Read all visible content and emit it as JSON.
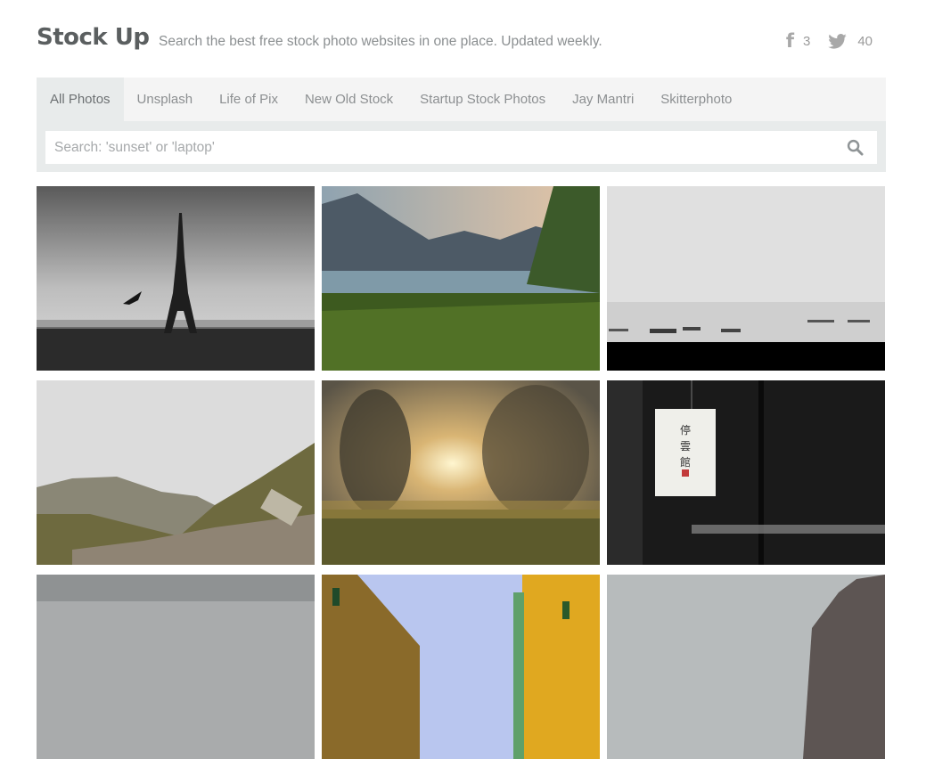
{
  "header": {
    "logo": "Stock Up",
    "tagline": "Search the best free stock photo websites in one place. Updated weekly.",
    "social": {
      "facebook": {
        "icon": "facebook-icon",
        "count": "3"
      },
      "twitter": {
        "icon": "twitter-icon",
        "count": "40"
      }
    }
  },
  "nav": {
    "tabs": [
      {
        "label": "All Photos",
        "active": true
      },
      {
        "label": "Unsplash",
        "active": false
      },
      {
        "label": "Life of Pix",
        "active": false
      },
      {
        "label": "New Old Stock",
        "active": false
      },
      {
        "label": "Startup Stock Photos",
        "active": false
      },
      {
        "label": "Jay Mantri",
        "active": false
      },
      {
        "label": "Skitterphoto",
        "active": false
      }
    ]
  },
  "search": {
    "placeholder": "Search: 'sunset' or 'laptop'",
    "value": "",
    "icon": "search-icon"
  },
  "photos": [
    {
      "subject": "Eiffel Tower black and white with bird"
    },
    {
      "subject": "Lake with mountains and tall grass at sunset"
    },
    {
      "subject": "Misty sea with ships"
    },
    {
      "subject": "Hiking trail on rocky hillside"
    },
    {
      "subject": "Sunlight through blurred trees over grass"
    },
    {
      "subject": "Paper lantern with calligraphy in dark room"
    },
    {
      "subject": "Cloudy sky"
    },
    {
      "subject": "Colorful houses along street"
    },
    {
      "subject": "Cloudy sky with cliff"
    }
  ]
}
